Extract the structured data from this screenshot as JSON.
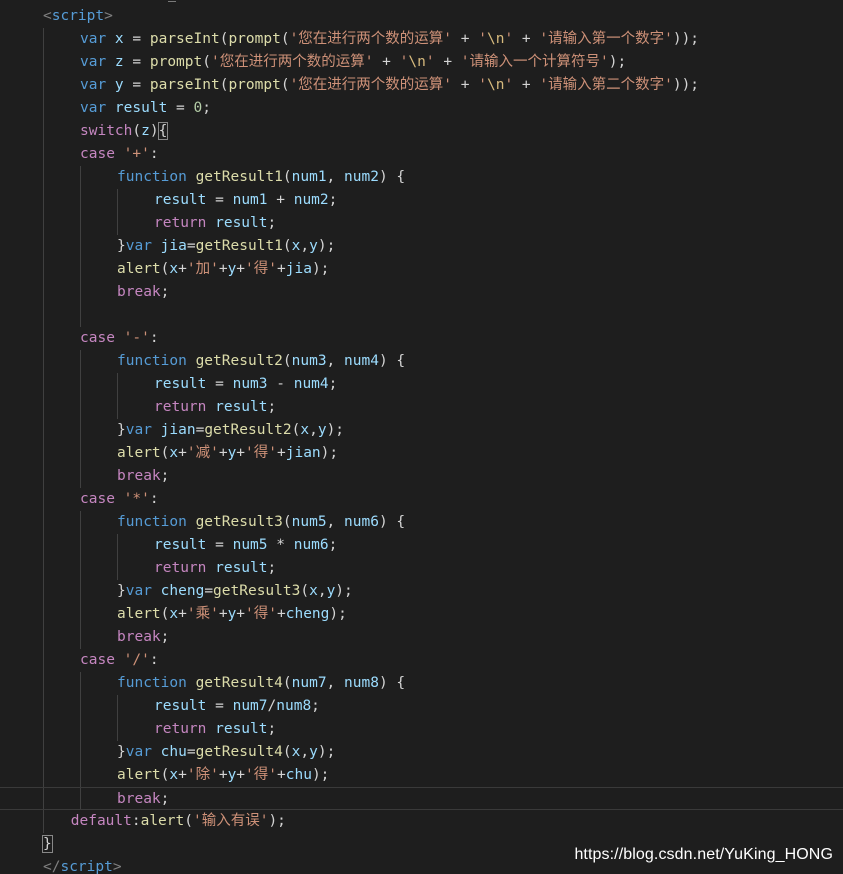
{
  "editor": {
    "lines": [
      {
        "indent": 1,
        "tokens": [
          {
            "t": "<",
            "c": "punct"
          },
          {
            "t": "script",
            "c": "tag"
          },
          {
            "t": ">",
            "c": "punct"
          }
        ]
      },
      {
        "indent": 2,
        "tokens": [
          {
            "t": "var ",
            "c": "kw"
          },
          {
            "t": "x",
            "c": "var"
          },
          {
            "t": " = ",
            "c": "op"
          },
          {
            "t": "parseInt",
            "c": "fn"
          },
          {
            "t": "(",
            "c": "op"
          },
          {
            "t": "prompt",
            "c": "fn"
          },
          {
            "t": "(",
            "c": "op"
          },
          {
            "t": "'您在进行两个数的运算'",
            "c": "str"
          },
          {
            "t": " + ",
            "c": "op"
          },
          {
            "t": "'",
            "c": "str"
          },
          {
            "t": "\\n",
            "c": "esc"
          },
          {
            "t": "'",
            "c": "str"
          },
          {
            "t": " + ",
            "c": "op"
          },
          {
            "t": "'请输入第一个数字'",
            "c": "str"
          },
          {
            "t": "));",
            "c": "op"
          }
        ]
      },
      {
        "indent": 2,
        "tokens": [
          {
            "t": "var ",
            "c": "kw"
          },
          {
            "t": "z",
            "c": "var"
          },
          {
            "t": " = ",
            "c": "op"
          },
          {
            "t": "prompt",
            "c": "fn"
          },
          {
            "t": "(",
            "c": "op"
          },
          {
            "t": "'您在进行两个数的运算'",
            "c": "str"
          },
          {
            "t": " + ",
            "c": "op"
          },
          {
            "t": "'",
            "c": "str"
          },
          {
            "t": "\\n",
            "c": "esc"
          },
          {
            "t": "'",
            "c": "str"
          },
          {
            "t": " + ",
            "c": "op"
          },
          {
            "t": "'请输入一个计算符号'",
            "c": "str"
          },
          {
            "t": ");",
            "c": "op"
          }
        ]
      },
      {
        "indent": 2,
        "tokens": [
          {
            "t": "var ",
            "c": "kw"
          },
          {
            "t": "y",
            "c": "var"
          },
          {
            "t": " = ",
            "c": "op"
          },
          {
            "t": "parseInt",
            "c": "fn"
          },
          {
            "t": "(",
            "c": "op"
          },
          {
            "t": "prompt",
            "c": "fn"
          },
          {
            "t": "(",
            "c": "op"
          },
          {
            "t": "'您在进行两个数的运算'",
            "c": "str"
          },
          {
            "t": " + ",
            "c": "op"
          },
          {
            "t": "'",
            "c": "str"
          },
          {
            "t": "\\n",
            "c": "esc"
          },
          {
            "t": "'",
            "c": "str"
          },
          {
            "t": " + ",
            "c": "op"
          },
          {
            "t": "'请输入第二个数字'",
            "c": "str"
          },
          {
            "t": "));",
            "c": "op"
          }
        ]
      },
      {
        "indent": 2,
        "tokens": [
          {
            "t": "var ",
            "c": "kw"
          },
          {
            "t": "result",
            "c": "var"
          },
          {
            "t": " = ",
            "c": "op"
          },
          {
            "t": "0",
            "c": "num"
          },
          {
            "t": ";",
            "c": "op"
          }
        ]
      },
      {
        "indent": 2,
        "tokens": [
          {
            "t": "switch",
            "c": "ctl"
          },
          {
            "t": "(",
            "c": "op"
          },
          {
            "t": "z",
            "c": "var"
          },
          {
            "t": ")",
            "c": "op"
          },
          {
            "t": "{",
            "c": "bracket-match"
          }
        ]
      },
      {
        "indent": 2,
        "tokens": [
          {
            "t": "case ",
            "c": "ctl"
          },
          {
            "t": "'+'",
            "c": "str"
          },
          {
            "t": ":",
            "c": "op"
          }
        ]
      },
      {
        "indent": 3,
        "tokens": [
          {
            "t": "function ",
            "c": "kw"
          },
          {
            "t": "getResult1",
            "c": "fn"
          },
          {
            "t": "(",
            "c": "op"
          },
          {
            "t": "num1",
            "c": "var"
          },
          {
            "t": ", ",
            "c": "op"
          },
          {
            "t": "num2",
            "c": "var"
          },
          {
            "t": ") {",
            "c": "op"
          }
        ]
      },
      {
        "indent": 4,
        "tokens": [
          {
            "t": "result",
            "c": "var"
          },
          {
            "t": " = ",
            "c": "op"
          },
          {
            "t": "num1",
            "c": "var"
          },
          {
            "t": " + ",
            "c": "op"
          },
          {
            "t": "num2",
            "c": "var"
          },
          {
            "t": ";",
            "c": "op"
          }
        ]
      },
      {
        "indent": 4,
        "tokens": [
          {
            "t": "return ",
            "c": "ctl"
          },
          {
            "t": "result",
            "c": "var"
          },
          {
            "t": ";",
            "c": "op"
          }
        ]
      },
      {
        "indent": 3,
        "tokens": [
          {
            "t": "}",
            "c": "op"
          },
          {
            "t": "var ",
            "c": "kw"
          },
          {
            "t": "jia",
            "c": "var"
          },
          {
            "t": "=",
            "c": "op"
          },
          {
            "t": "getResult1",
            "c": "fn"
          },
          {
            "t": "(",
            "c": "op"
          },
          {
            "t": "x",
            "c": "var"
          },
          {
            "t": ",",
            "c": "op"
          },
          {
            "t": "y",
            "c": "var"
          },
          {
            "t": ");",
            "c": "op"
          }
        ]
      },
      {
        "indent": 3,
        "tokens": [
          {
            "t": "alert",
            "c": "fn"
          },
          {
            "t": "(",
            "c": "op"
          },
          {
            "t": "x",
            "c": "var"
          },
          {
            "t": "+",
            "c": "op"
          },
          {
            "t": "'加'",
            "c": "str"
          },
          {
            "t": "+",
            "c": "op"
          },
          {
            "t": "y",
            "c": "var"
          },
          {
            "t": "+",
            "c": "op"
          },
          {
            "t": "'得'",
            "c": "str"
          },
          {
            "t": "+",
            "c": "op"
          },
          {
            "t": "jia",
            "c": "var"
          },
          {
            "t": ");",
            "c": "op"
          }
        ]
      },
      {
        "indent": 3,
        "tokens": [
          {
            "t": "break",
            "c": "ctl"
          },
          {
            "t": ";",
            "c": "op"
          }
        ]
      },
      {
        "indent": 0,
        "tokens": []
      },
      {
        "indent": 2,
        "tokens": [
          {
            "t": "case ",
            "c": "ctl"
          },
          {
            "t": "'-'",
            "c": "str"
          },
          {
            "t": ":",
            "c": "op"
          }
        ]
      },
      {
        "indent": 3,
        "tokens": [
          {
            "t": "function ",
            "c": "kw"
          },
          {
            "t": "getResult2",
            "c": "fn"
          },
          {
            "t": "(",
            "c": "op"
          },
          {
            "t": "num3",
            "c": "var"
          },
          {
            "t": ", ",
            "c": "op"
          },
          {
            "t": "num4",
            "c": "var"
          },
          {
            "t": ") {",
            "c": "op"
          }
        ]
      },
      {
        "indent": 4,
        "tokens": [
          {
            "t": "result",
            "c": "var"
          },
          {
            "t": " = ",
            "c": "op"
          },
          {
            "t": "num3",
            "c": "var"
          },
          {
            "t": " - ",
            "c": "op"
          },
          {
            "t": "num4",
            "c": "var"
          },
          {
            "t": ";",
            "c": "op"
          }
        ]
      },
      {
        "indent": 4,
        "tokens": [
          {
            "t": "return ",
            "c": "ctl"
          },
          {
            "t": "result",
            "c": "var"
          },
          {
            "t": ";",
            "c": "op"
          }
        ]
      },
      {
        "indent": 3,
        "tokens": [
          {
            "t": "}",
            "c": "op"
          },
          {
            "t": "var ",
            "c": "kw"
          },
          {
            "t": "jian",
            "c": "var"
          },
          {
            "t": "=",
            "c": "op"
          },
          {
            "t": "getResult2",
            "c": "fn"
          },
          {
            "t": "(",
            "c": "op"
          },
          {
            "t": "x",
            "c": "var"
          },
          {
            "t": ",",
            "c": "op"
          },
          {
            "t": "y",
            "c": "var"
          },
          {
            "t": ");",
            "c": "op"
          }
        ]
      },
      {
        "indent": 3,
        "tokens": [
          {
            "t": "alert",
            "c": "fn"
          },
          {
            "t": "(",
            "c": "op"
          },
          {
            "t": "x",
            "c": "var"
          },
          {
            "t": "+",
            "c": "op"
          },
          {
            "t": "'减'",
            "c": "str"
          },
          {
            "t": "+",
            "c": "op"
          },
          {
            "t": "y",
            "c": "var"
          },
          {
            "t": "+",
            "c": "op"
          },
          {
            "t": "'得'",
            "c": "str"
          },
          {
            "t": "+",
            "c": "op"
          },
          {
            "t": "jian",
            "c": "var"
          },
          {
            "t": ");",
            "c": "op"
          }
        ]
      },
      {
        "indent": 3,
        "tokens": [
          {
            "t": "break",
            "c": "ctl"
          },
          {
            "t": ";",
            "c": "op"
          }
        ]
      },
      {
        "indent": 2,
        "tokens": [
          {
            "t": "case ",
            "c": "ctl"
          },
          {
            "t": "'*'",
            "c": "str"
          },
          {
            "t": ":",
            "c": "op"
          }
        ]
      },
      {
        "indent": 3,
        "tokens": [
          {
            "t": "function ",
            "c": "kw"
          },
          {
            "t": "getResult3",
            "c": "fn"
          },
          {
            "t": "(",
            "c": "op"
          },
          {
            "t": "num5",
            "c": "var"
          },
          {
            "t": ", ",
            "c": "op"
          },
          {
            "t": "num6",
            "c": "var"
          },
          {
            "t": ") {",
            "c": "op"
          }
        ]
      },
      {
        "indent": 4,
        "tokens": [
          {
            "t": "result",
            "c": "var"
          },
          {
            "t": " = ",
            "c": "op"
          },
          {
            "t": "num5",
            "c": "var"
          },
          {
            "t": " * ",
            "c": "op"
          },
          {
            "t": "num6",
            "c": "var"
          },
          {
            "t": ";",
            "c": "op"
          }
        ]
      },
      {
        "indent": 4,
        "tokens": [
          {
            "t": "return ",
            "c": "ctl"
          },
          {
            "t": "result",
            "c": "var"
          },
          {
            "t": ";",
            "c": "op"
          }
        ]
      },
      {
        "indent": 3,
        "tokens": [
          {
            "t": "}",
            "c": "op"
          },
          {
            "t": "var ",
            "c": "kw"
          },
          {
            "t": "cheng",
            "c": "var"
          },
          {
            "t": "=",
            "c": "op"
          },
          {
            "t": "getResult3",
            "c": "fn"
          },
          {
            "t": "(",
            "c": "op"
          },
          {
            "t": "x",
            "c": "var"
          },
          {
            "t": ",",
            "c": "op"
          },
          {
            "t": "y",
            "c": "var"
          },
          {
            "t": ");",
            "c": "op"
          }
        ]
      },
      {
        "indent": 3,
        "tokens": [
          {
            "t": "alert",
            "c": "fn"
          },
          {
            "t": "(",
            "c": "op"
          },
          {
            "t": "x",
            "c": "var"
          },
          {
            "t": "+",
            "c": "op"
          },
          {
            "t": "'乘'",
            "c": "str"
          },
          {
            "t": "+",
            "c": "op"
          },
          {
            "t": "y",
            "c": "var"
          },
          {
            "t": "+",
            "c": "op"
          },
          {
            "t": "'得'",
            "c": "str"
          },
          {
            "t": "+",
            "c": "op"
          },
          {
            "t": "cheng",
            "c": "var"
          },
          {
            "t": ");",
            "c": "op"
          }
        ]
      },
      {
        "indent": 3,
        "tokens": [
          {
            "t": "break",
            "c": "ctl"
          },
          {
            "t": ";",
            "c": "op"
          }
        ]
      },
      {
        "indent": 2,
        "tokens": [
          {
            "t": "case ",
            "c": "ctl"
          },
          {
            "t": "'/'",
            "c": "str"
          },
          {
            "t": ":",
            "c": "op"
          }
        ]
      },
      {
        "indent": 3,
        "tokens": [
          {
            "t": "function ",
            "c": "kw"
          },
          {
            "t": "getResult4",
            "c": "fn"
          },
          {
            "t": "(",
            "c": "op"
          },
          {
            "t": "num7",
            "c": "var"
          },
          {
            "t": ", ",
            "c": "op"
          },
          {
            "t": "num8",
            "c": "var"
          },
          {
            "t": ") {",
            "c": "op"
          }
        ]
      },
      {
        "indent": 4,
        "tokens": [
          {
            "t": "result",
            "c": "var"
          },
          {
            "t": " = ",
            "c": "op"
          },
          {
            "t": "num7",
            "c": "var"
          },
          {
            "t": "/",
            "c": "op"
          },
          {
            "t": "num8",
            "c": "var"
          },
          {
            "t": ";",
            "c": "op"
          }
        ]
      },
      {
        "indent": 4,
        "tokens": [
          {
            "t": "return ",
            "c": "ctl"
          },
          {
            "t": "result",
            "c": "var"
          },
          {
            "t": ";",
            "c": "op"
          }
        ]
      },
      {
        "indent": 3,
        "tokens": [
          {
            "t": "}",
            "c": "op"
          },
          {
            "t": "var ",
            "c": "kw"
          },
          {
            "t": "chu",
            "c": "var"
          },
          {
            "t": "=",
            "c": "op"
          },
          {
            "t": "getResult4",
            "c": "fn"
          },
          {
            "t": "(",
            "c": "op"
          },
          {
            "t": "x",
            "c": "var"
          },
          {
            "t": ",",
            "c": "op"
          },
          {
            "t": "y",
            "c": "var"
          },
          {
            "t": ");",
            "c": "op"
          }
        ]
      },
      {
        "indent": 3,
        "tokens": [
          {
            "t": "alert",
            "c": "fn"
          },
          {
            "t": "(",
            "c": "op"
          },
          {
            "t": "x",
            "c": "var"
          },
          {
            "t": "+",
            "c": "op"
          },
          {
            "t": "'除'",
            "c": "str"
          },
          {
            "t": "+",
            "c": "op"
          },
          {
            "t": "y",
            "c": "var"
          },
          {
            "t": "+",
            "c": "op"
          },
          {
            "t": "'得'",
            "c": "str"
          },
          {
            "t": "+",
            "c": "op"
          },
          {
            "t": "chu",
            "c": "var"
          },
          {
            "t": ");",
            "c": "op"
          }
        ]
      },
      {
        "indent": 3,
        "tokens": [
          {
            "t": "break",
            "c": "ctl"
          },
          {
            "t": ";",
            "c": "op"
          }
        ],
        "current": true
      },
      {
        "indent": 1.75,
        "tokens": [
          {
            "t": "default",
            "c": "ctl"
          },
          {
            "t": ":",
            "c": "op"
          },
          {
            "t": "alert",
            "c": "fn"
          },
          {
            "t": "(",
            "c": "op"
          },
          {
            "t": "'输入有误'",
            "c": "str"
          },
          {
            "t": ");",
            "c": "op"
          }
        ]
      },
      {
        "indent": 1,
        "tokens": [
          {
            "t": "}",
            "c": "bracket-match"
          }
        ]
      },
      {
        "indent": 1,
        "tokens": [
          {
            "t": "</",
            "c": "punct"
          },
          {
            "t": "script",
            "c": "tag"
          },
          {
            "t": ">",
            "c": "punct"
          }
        ]
      }
    ]
  },
  "watermark": "https://blog.csdn.net/YuKing_HONG",
  "colors": {
    "background": "#1e1e1e",
    "keyword": "#569cd6",
    "control": "#c586c0",
    "variable": "#9cdcfe",
    "function": "#dcdcaa",
    "string": "#ce9178",
    "number": "#b5cea8",
    "escape": "#d7ba7d"
  }
}
